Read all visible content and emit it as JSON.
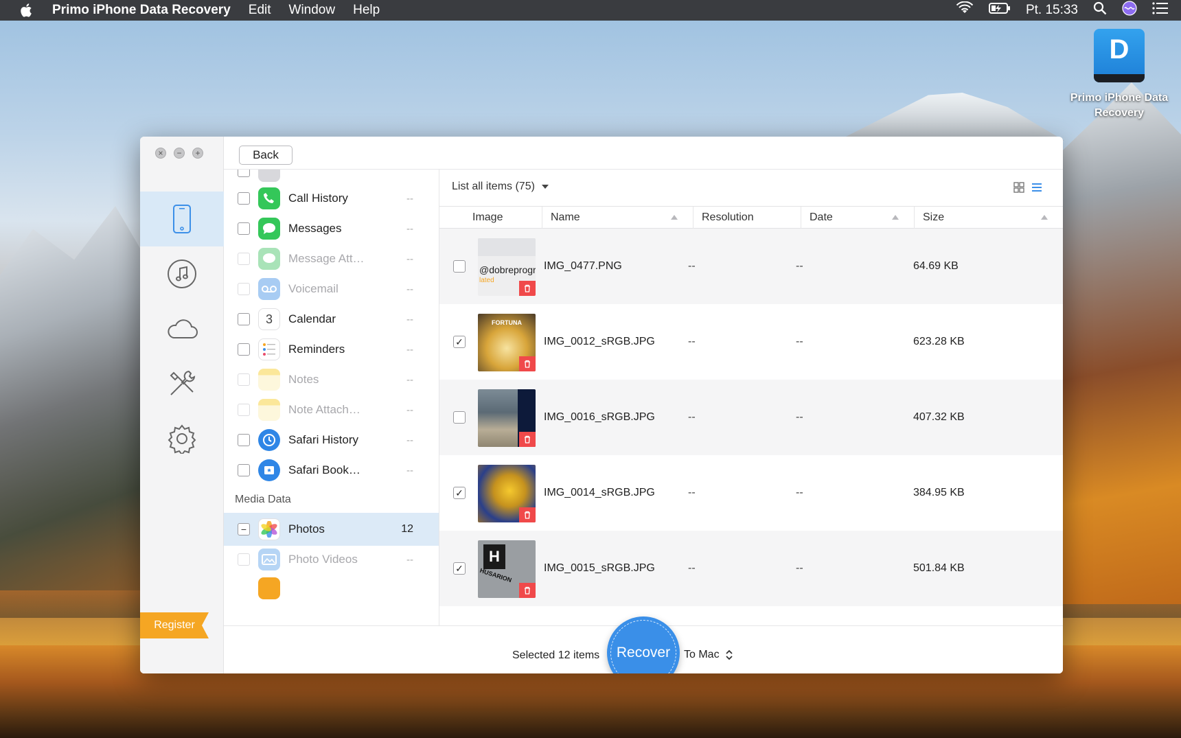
{
  "menubar": {
    "app_name": "Primo iPhone Data Recovery",
    "menus": [
      "Edit",
      "Window",
      "Help"
    ],
    "clock": "Pt. 15:33"
  },
  "desktop_icon": {
    "label": "Primo iPhone Data Recovery",
    "glyph": "D"
  },
  "window": {
    "back_label": "Back",
    "register_label": "Register",
    "sidebar_icons": [
      "iphone-icon",
      "music-icon",
      "cloud-icon",
      "tools-icon",
      "settings-icon"
    ],
    "categories": [
      {
        "label": "Call History",
        "count": "--",
        "enabled": true,
        "checked": false,
        "icon": "phone-icon",
        "color": "#34c759"
      },
      {
        "label": "Messages",
        "count": "--",
        "enabled": true,
        "checked": false,
        "icon": "messages-icon",
        "color": "#34c759"
      },
      {
        "label": "Message Att…",
        "count": "--",
        "enabled": false,
        "checked": false,
        "icon": "message-attachment-icon",
        "color": "#34c759"
      },
      {
        "label": "Voicemail",
        "count": "--",
        "enabled": false,
        "checked": false,
        "icon": "voicemail-icon",
        "color": "#3b8fe8"
      },
      {
        "label": "Calendar",
        "count": "--",
        "enabled": true,
        "checked": false,
        "icon": "calendar-icon",
        "color": "#ffffff",
        "glyph": "3"
      },
      {
        "label": "Reminders",
        "count": "--",
        "enabled": true,
        "checked": false,
        "icon": "reminders-icon",
        "color": "#ffffff"
      },
      {
        "label": "Notes",
        "count": "--",
        "enabled": false,
        "checked": false,
        "icon": "notes-icon",
        "color": "#f7d54a"
      },
      {
        "label": "Note Attach…",
        "count": "--",
        "enabled": false,
        "checked": false,
        "icon": "note-attachment-icon",
        "color": "#f7d54a"
      },
      {
        "label": "Safari History",
        "count": "--",
        "enabled": true,
        "checked": false,
        "icon": "safari-history-icon",
        "color": "#2f86e6"
      },
      {
        "label": "Safari Book…",
        "count": "--",
        "enabled": true,
        "checked": false,
        "icon": "safari-bookmark-icon",
        "color": "#2f86e6"
      }
    ],
    "media_section_label": "Media Data",
    "media_categories": [
      {
        "label": "Photos",
        "count": "12",
        "enabled": true,
        "state": "partial",
        "icon": "photos-icon",
        "selected": true
      },
      {
        "label": "Photo Videos",
        "count": "--",
        "enabled": false,
        "state": "none",
        "icon": "photo-videos-icon",
        "selected": false
      }
    ],
    "list_filter": "List all items (75)",
    "columns": [
      "Image",
      "Name",
      "Resolution",
      "Date",
      "Size"
    ],
    "rows": [
      {
        "name": "IMG_0477.PNG",
        "resolution": "--",
        "date": "--",
        "size": "64.69 KB",
        "checked": false,
        "thumb_text": "@dobreprogr",
        "thumb_sub": "lated",
        "thumb_color": "#eeeeef"
      },
      {
        "name": "IMG_0012_sRGB.JPG",
        "resolution": "--",
        "date": "--",
        "size": "623.28 KB",
        "checked": true,
        "thumb_text": "FORTUNA",
        "thumb_color": "#c98a2a"
      },
      {
        "name": "IMG_0016_sRGB.JPG",
        "resolution": "--",
        "date": "--",
        "size": "407.32 KB",
        "checked": false,
        "thumb_color": "#5b6a75"
      },
      {
        "name": "IMG_0014_sRGB.JPG",
        "resolution": "--",
        "date": "--",
        "size": "384.95 KB",
        "checked": true,
        "thumb_color": "#c69a2a"
      },
      {
        "name": "IMG_0015_sRGB.JPG",
        "resolution": "--",
        "date": "--",
        "size": "501.84 KB",
        "checked": true,
        "thumb_text": "HUSARION",
        "thumb_color": "#9a9ea2"
      }
    ],
    "selected_text": "Selected 12 items",
    "recover_label": "Recover",
    "destination": "To Mac"
  },
  "colors": {
    "accent": "#3a8fe8",
    "register": "#f5a623",
    "trash": "#f0494a"
  }
}
